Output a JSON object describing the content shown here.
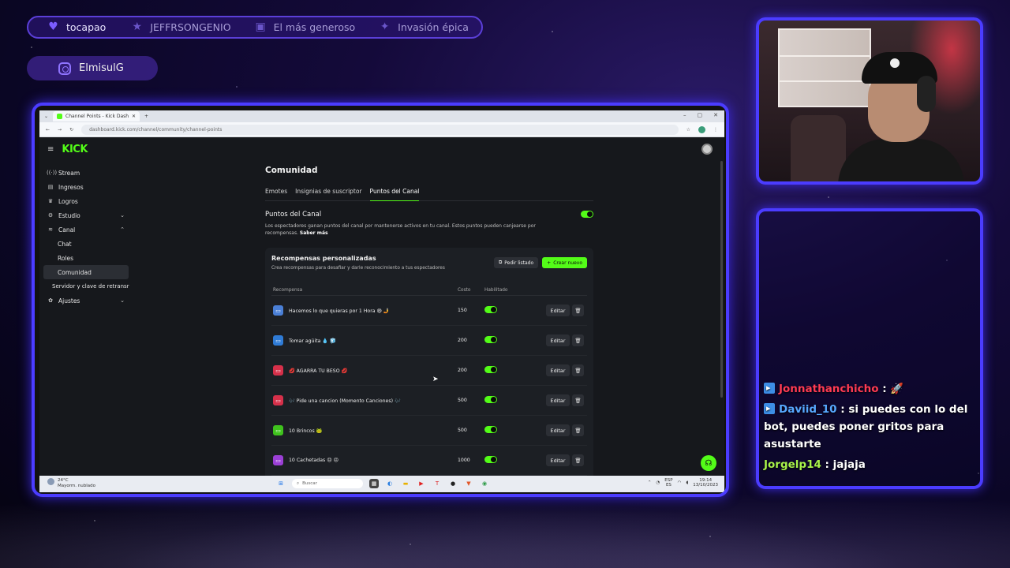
{
  "alerts": [
    {
      "icon": "heart-icon",
      "label": "tocapao"
    },
    {
      "icon": "star-icon",
      "label": "JEFFRSONGENIO"
    },
    {
      "icon": "gift-icon",
      "label": "El más generoso"
    },
    {
      "icon": "raid-icon",
      "label": "Invasión épica"
    }
  ],
  "social": {
    "handle": "ElmisulG"
  },
  "browser": {
    "tab_title": "Channel Points - Kick Dashboard",
    "url": "dashboard.kick.com/channel/community/channel-points"
  },
  "kick": {
    "logo": "KICK",
    "sidebar": {
      "stream": "Stream",
      "ingresos": "Ingresos",
      "logros": "Logros",
      "estudio": "Estudio",
      "canal": "Canal",
      "chat": "Chat",
      "roles": "Roles",
      "comunidad": "Comunidad",
      "servidor": "Servidor y clave de retransr",
      "ajustes": "Ajustes"
    },
    "page_title": "Comunidad",
    "tabs": {
      "emotes": "Emotes",
      "insignias": "Insignias de suscriptor",
      "puntos": "Puntos del Canal"
    },
    "points": {
      "title": "Puntos del Canal",
      "desc": "Los espectadores ganan puntos del canal por mantenerse activos en tu canal. Estos puntos pueden canjearse por recompensas.",
      "learn_more": "Saber más",
      "enabled": true
    },
    "rewards": {
      "title": "Recompensas personalizadas",
      "subtitle": "Crea recompensas para desafiar y darle reconocimiento a tus espectadores",
      "list_button": "Pedir listado",
      "create_button": "Crear nuevo",
      "col_reward": "Recompensa",
      "col_cost": "Costo",
      "col_enabled": "Habilitado",
      "edit_label": "Editar",
      "items": [
        {
          "name": "Hacemos lo que quieras por 1 Hora 😄 🤳",
          "cost": "150",
          "color": "#4a7fd6",
          "enabled": true
        },
        {
          "name": "Tomar agüita 💧 🧊",
          "cost": "200",
          "color": "#2f7bd6",
          "enabled": true
        },
        {
          "name": "💋 AGARRA TU BESO 💋",
          "cost": "200",
          "color": "#d6304a",
          "enabled": true
        },
        {
          "name": "🎶 Pide una cancion (Momento Canciones) 🎶",
          "cost": "500",
          "color": "#d6304a",
          "enabled": true
        },
        {
          "name": "10 Brincos 🐸",
          "cost": "500",
          "color": "#3fc21d",
          "enabled": true
        },
        {
          "name": "10 Cachetadas 😣 😣",
          "cost": "1000",
          "color": "#9b3fd6",
          "enabled": true
        }
      ]
    }
  },
  "taskbar": {
    "weather_temp": "24°C",
    "weather_desc": "Mayorm. nublado",
    "search": "Buscar",
    "lang": "ESP",
    "lang2": "ES",
    "time": "19:14",
    "date": "13/10/2023"
  },
  "chat": [
    {
      "user": "Jonnathanchicho",
      "text": " : 🚀",
      "color": "#ff3b53"
    },
    {
      "user": "Daviid_10",
      "text": " : si puedes con lo del bot, puedes poner gritos para asustarte",
      "color": "#57a8ff"
    },
    {
      "user": "Jorgelp14",
      "text": " : jajaja",
      "color": "#a8f24a"
    }
  ]
}
